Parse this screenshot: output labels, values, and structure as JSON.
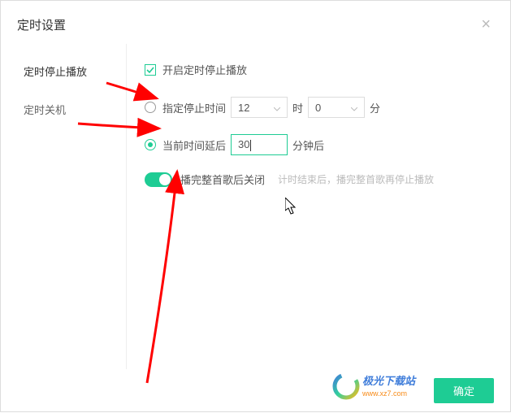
{
  "header": {
    "title": "定时设置"
  },
  "sidebar": {
    "items": [
      {
        "label": "定时停止播放",
        "active": true
      },
      {
        "label": "定时关机",
        "active": false
      }
    ]
  },
  "content": {
    "enable_label": "开启定时停止播放",
    "specify_time_label": "指定停止时间",
    "hour_value": "12",
    "hour_unit": "时",
    "minute_value": "0",
    "minute_unit": "分",
    "delay_label": "当前时间延后",
    "delay_value": "30",
    "delay_unit": "分钟后",
    "finish_song_label": "播完整首歌后关闭",
    "finish_song_hint": "计时结束后，播完整首歌再停止播放"
  },
  "footer": {
    "confirm": "确定"
  },
  "watermark": {
    "text": "极光下载站",
    "url": "www.xz7.com"
  },
  "colors": {
    "accent": "#1ecc94",
    "arrow": "#ff0000"
  }
}
